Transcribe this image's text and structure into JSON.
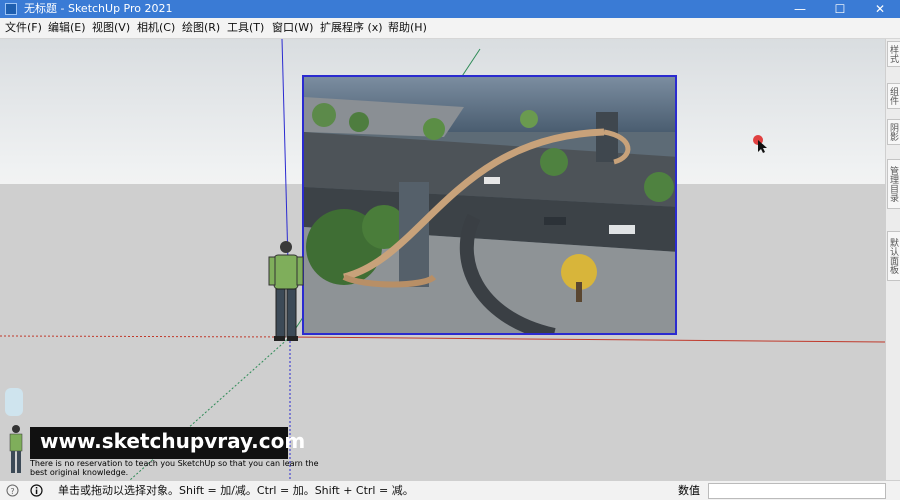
{
  "window": {
    "title": "无标题 - SketchUp Pro 2021",
    "minimize": "—",
    "maximize": "☐",
    "close": "✕"
  },
  "menu": [
    "文件(F)",
    "编辑(E)",
    "视图(V)",
    "相机(C)",
    "绘图(R)",
    "工具(T)",
    "窗口(W)",
    "扩展程序 (x)",
    "帮助(H)"
  ],
  "right_panel": {
    "tabs": [
      "样式",
      "组件",
      "阴影",
      "管理目录",
      "默认面板"
    ]
  },
  "viewport": {
    "imported_image": "bridge-rendering-image",
    "human_figure": "scale-figure",
    "cursor": "arrow-cursor"
  },
  "watermark": {
    "url": "www.sketchupvray.com",
    "note": "There is no reservation to teach you SketchUp so that you can learn the best original knowledge."
  },
  "status": {
    "message": "单击或拖动以选择对象。Shift = 加/减。Ctrl = 加。Shift + Ctrl = 减。",
    "value_label": "数值",
    "value": ""
  },
  "colors": {
    "titlebar": "#3a7bd5",
    "selection": "#2b2bd0",
    "red_axis": "#c0392b",
    "green_axis": "#2e8b57",
    "blue_axis": "#2b2bd0"
  }
}
